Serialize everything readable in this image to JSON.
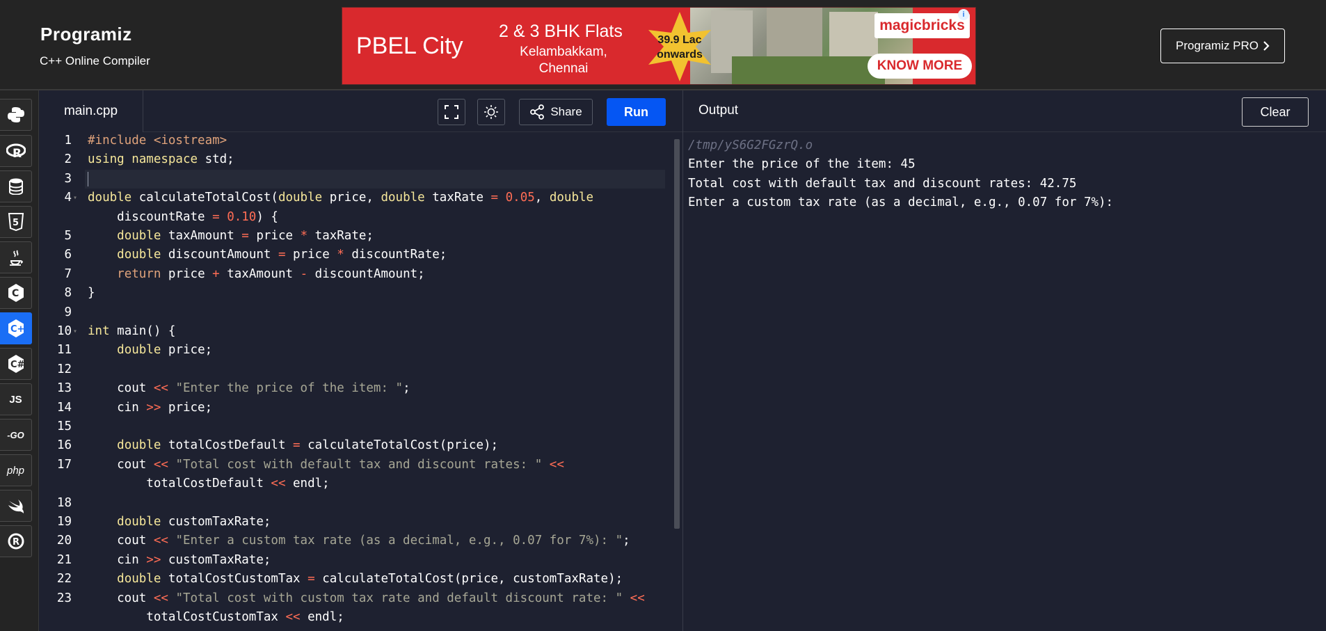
{
  "header": {
    "logo_text": "Programiz",
    "subtitle": "C++ Online Compiler",
    "pro_button_label": "Programiz PRO",
    "pro_button_icon": "chevron-right-icon"
  },
  "ad": {
    "title": "PBEL City",
    "headline": "2 & 3 BHK Flats",
    "location_line1": "Kelambakkam,",
    "location_line2": "Chennai",
    "price_line1": "39.9 Lac",
    "price_line2": "onwards",
    "brand": "magicbricks",
    "cta": "KNOW MORE",
    "info_icon": "i"
  },
  "sidebar": {
    "items": [
      {
        "name": "python",
        "label": "",
        "active": false
      },
      {
        "name": "r",
        "label": "",
        "active": false
      },
      {
        "name": "sql",
        "label": "",
        "active": false
      },
      {
        "name": "html",
        "label": "",
        "active": false
      },
      {
        "name": "java",
        "label": "",
        "active": false
      },
      {
        "name": "c",
        "label": "",
        "active": false
      },
      {
        "name": "cpp",
        "label": "",
        "active": true
      },
      {
        "name": "csharp",
        "label": "",
        "active": false
      },
      {
        "name": "js",
        "label": "JS",
        "active": false
      },
      {
        "name": "go",
        "label": "-GO",
        "active": false
      },
      {
        "name": "php",
        "label": "php",
        "active": false
      },
      {
        "name": "swift",
        "label": "",
        "active": false
      },
      {
        "name": "rust",
        "label": "",
        "active": false
      }
    ]
  },
  "editor": {
    "tab_label": "main.cpp",
    "share_label": "Share",
    "run_label": "Run",
    "current_line": 3
  },
  "code_lines": [
    {
      "n": "1",
      "tokens": [
        [
          "pp",
          "#include "
        ],
        [
          "pp",
          "<iostream>"
        ]
      ]
    },
    {
      "n": "2",
      "tokens": [
        [
          "kw",
          "using namespace "
        ],
        [
          "plain",
          "std;"
        ]
      ]
    },
    {
      "n": "3",
      "tokens": []
    },
    {
      "n": "4",
      "fold": true,
      "tokens": [
        [
          "ty",
          "double "
        ],
        [
          "plain",
          "calculateTotalCost("
        ],
        [
          "ty",
          "double "
        ],
        [
          "plain",
          "price, "
        ],
        [
          "ty",
          "double "
        ],
        [
          "plain",
          "taxRate "
        ],
        [
          "op",
          "= "
        ],
        [
          "num",
          "0.05"
        ],
        [
          "plain",
          ", "
        ],
        [
          "ty",
          "double"
        ]
      ]
    },
    {
      "n": "",
      "tokens": [
        [
          "plain",
          "    discountRate "
        ],
        [
          "op",
          "= "
        ],
        [
          "num",
          "0.10"
        ],
        [
          "plain",
          ") {"
        ]
      ]
    },
    {
      "n": "5",
      "tokens": [
        [
          "plain",
          "    "
        ],
        [
          "ty",
          "double "
        ],
        [
          "plain",
          "taxAmount "
        ],
        [
          "op",
          "= "
        ],
        [
          "plain",
          "price "
        ],
        [
          "op",
          "* "
        ],
        [
          "plain",
          "taxRate;"
        ]
      ]
    },
    {
      "n": "6",
      "tokens": [
        [
          "plain",
          "    "
        ],
        [
          "ty",
          "double "
        ],
        [
          "plain",
          "discountAmount "
        ],
        [
          "op",
          "= "
        ],
        [
          "plain",
          "price "
        ],
        [
          "op",
          "* "
        ],
        [
          "plain",
          "discountRate;"
        ]
      ]
    },
    {
      "n": "7",
      "tokens": [
        [
          "plain",
          "    "
        ],
        [
          "pp",
          "return "
        ],
        [
          "plain",
          "price "
        ],
        [
          "op",
          "+ "
        ],
        [
          "plain",
          "taxAmount "
        ],
        [
          "op",
          "- "
        ],
        [
          "plain",
          "discountAmount;"
        ]
      ]
    },
    {
      "n": "8",
      "tokens": [
        [
          "plain",
          "}"
        ]
      ]
    },
    {
      "n": "9",
      "tokens": []
    },
    {
      "n": "10",
      "fold": true,
      "tokens": [
        [
          "ty",
          "int "
        ],
        [
          "plain",
          "main() {"
        ]
      ]
    },
    {
      "n": "11",
      "tokens": [
        [
          "plain",
          "    "
        ],
        [
          "ty",
          "double "
        ],
        [
          "plain",
          "price;"
        ]
      ]
    },
    {
      "n": "12",
      "tokens": []
    },
    {
      "n": "13",
      "tokens": [
        [
          "plain",
          "    cout "
        ],
        [
          "op",
          "<< "
        ],
        [
          "str",
          "\"Enter the price of the item: \""
        ],
        [
          "plain",
          ";"
        ]
      ]
    },
    {
      "n": "14",
      "tokens": [
        [
          "plain",
          "    cin "
        ],
        [
          "op",
          ">> "
        ],
        [
          "plain",
          "price;"
        ]
      ]
    },
    {
      "n": "15",
      "tokens": []
    },
    {
      "n": "16",
      "tokens": [
        [
          "plain",
          "    "
        ],
        [
          "ty",
          "double "
        ],
        [
          "plain",
          "totalCostDefault "
        ],
        [
          "op",
          "= "
        ],
        [
          "plain",
          "calculateTotalCost(price);"
        ]
      ]
    },
    {
      "n": "17",
      "tokens": [
        [
          "plain",
          "    cout "
        ],
        [
          "op",
          "<< "
        ],
        [
          "str",
          "\"Total cost with default tax and discount rates: \" "
        ],
        [
          "op",
          "<<"
        ]
      ]
    },
    {
      "n": "",
      "tokens": [
        [
          "plain",
          "        totalCostDefault "
        ],
        [
          "op",
          "<< "
        ],
        [
          "plain",
          "endl;"
        ]
      ]
    },
    {
      "n": "18",
      "tokens": []
    },
    {
      "n": "19",
      "tokens": [
        [
          "plain",
          "    "
        ],
        [
          "ty",
          "double "
        ],
        [
          "plain",
          "customTaxRate;"
        ]
      ]
    },
    {
      "n": "20",
      "tokens": [
        [
          "plain",
          "    cout "
        ],
        [
          "op",
          "<< "
        ],
        [
          "str",
          "\"Enter a custom tax rate (as a decimal, e.g., 0.07 for 7%): \""
        ],
        [
          "plain",
          ";"
        ]
      ]
    },
    {
      "n": "21",
      "tokens": [
        [
          "plain",
          "    cin "
        ],
        [
          "op",
          ">> "
        ],
        [
          "plain",
          "customTaxRate;"
        ]
      ]
    },
    {
      "n": "22",
      "tokens": [
        [
          "plain",
          "    "
        ],
        [
          "ty",
          "double "
        ],
        [
          "plain",
          "totalCostCustomTax "
        ],
        [
          "op",
          "= "
        ],
        [
          "plain",
          "calculateTotalCost(price, customTaxRate);"
        ]
      ]
    },
    {
      "n": "23",
      "tokens": [
        [
          "plain",
          "    cout "
        ],
        [
          "op",
          "<< "
        ],
        [
          "str",
          "\"Total cost with custom tax rate and default discount rate: \" "
        ],
        [
          "op",
          "<<"
        ]
      ]
    },
    {
      "n": "",
      "tokens": [
        [
          "plain",
          "        totalCostCustomTax "
        ],
        [
          "op",
          "<< "
        ],
        [
          "plain",
          "endl;"
        ]
      ]
    }
  ],
  "output": {
    "title": "Output",
    "clear_label": "Clear",
    "lines": [
      {
        "text": "/tmp/yS6G2FGzrQ.o",
        "kind": "path"
      },
      {
        "text": "Enter the price of the item: 45",
        "kind": "normal"
      },
      {
        "text": "Total cost with default tax and discount rates: 42.75",
        "kind": "normal"
      },
      {
        "text": "Enter a custom tax rate (as a decimal, e.g., 0.07 for 7%):",
        "kind": "normal"
      }
    ]
  },
  "colors": {
    "run_button": "#0556f3",
    "active_language": "#1a6ef5",
    "ad_background": "#d9292d",
    "editor_background": "#1e2130"
  }
}
